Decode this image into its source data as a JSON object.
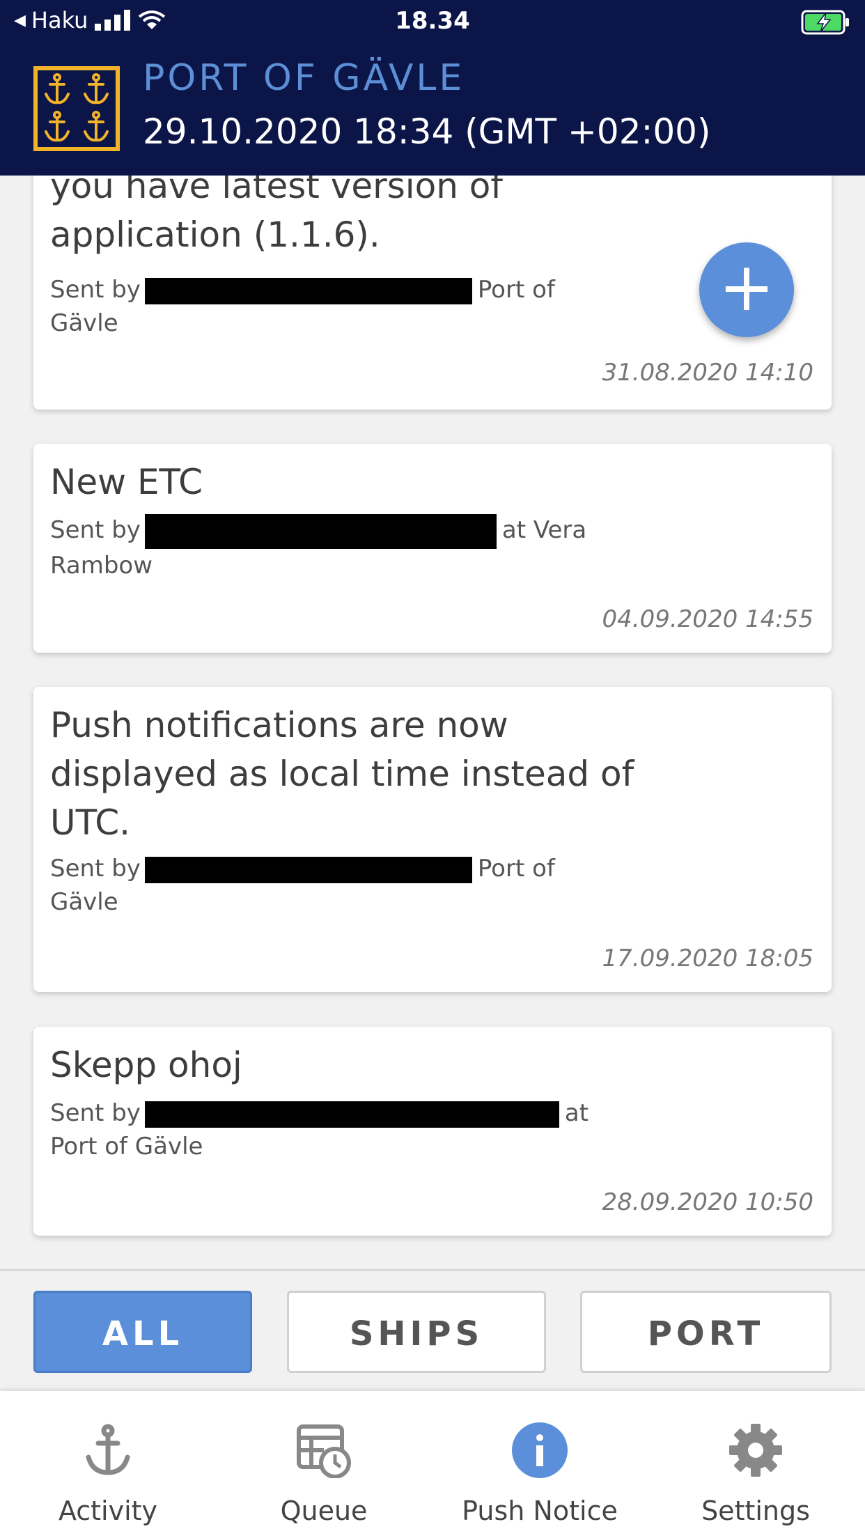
{
  "status_bar": {
    "back_label": "Haku",
    "time": "18.34"
  },
  "header": {
    "port_name": "PORT OF GÄVLE",
    "datetime": "29.10.2020 18:34 (GMT +02:00)"
  },
  "notices": [
    {
      "title": "you have latest version of application (1.1.6).",
      "sent_prefix": "Sent by",
      "sent_suffix": "Port of",
      "sent_line2": "Gävle",
      "date": "31.08.2020 14:10"
    },
    {
      "title": "New ETC",
      "sent_prefix": "Sent by",
      "sent_suffix": "at Vera",
      "sent_line2": "Rambow",
      "date": "04.09.2020 14:55"
    },
    {
      "title": "Push notifications are now displayed as local time instead of UTC.",
      "sent_prefix": "Sent by",
      "sent_suffix": "Port of",
      "sent_line2": "Gävle",
      "date": "17.09.2020 18:05"
    },
    {
      "title": "Skepp ohoj",
      "sent_prefix": "Sent by",
      "sent_suffix": "at",
      "sent_line2": "Port of Gävle",
      "date": "28.09.2020 10:50"
    }
  ],
  "fab": {
    "label": "+"
  },
  "filters": {
    "all": "ALL",
    "ships": "SHIPS",
    "port": "PORT",
    "active": "all"
  },
  "tabs": {
    "activity": "Activity",
    "queue": "Queue",
    "push": "Push Notice",
    "settings": "Settings",
    "active": "push"
  },
  "colors": {
    "header_bg": "#0c1547",
    "accent": "#5b8fd9",
    "logo_gold": "#f2b32a"
  }
}
